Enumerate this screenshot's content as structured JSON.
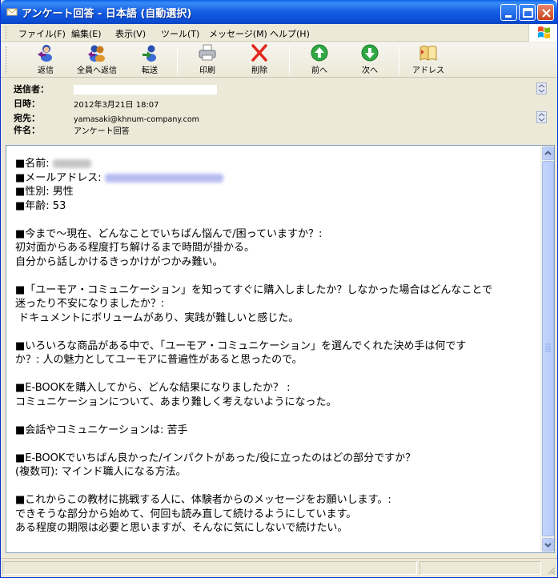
{
  "window": {
    "title": "アンケート回答 - 日本語 (自動選択)"
  },
  "menu": {
    "items": [
      {
        "label": "ファイル(F)"
      },
      {
        "label": "編集(E)"
      },
      {
        "label": "表示(V)"
      },
      {
        "label": "ツール(T)"
      },
      {
        "label": "メッセージ(M)"
      },
      {
        "label": "ヘルプ(H)"
      }
    ]
  },
  "toolbar": {
    "reply": "返信",
    "reply_all": "全員へ返信",
    "forward": "転送",
    "print": "印刷",
    "delete": "削除",
    "previous": "前へ",
    "next": "次へ",
    "address": "アドレス"
  },
  "header": {
    "from_label": "送信者：",
    "date_label": "日時：",
    "date_value": "2012年3月21日 18:07",
    "to_label": "宛先：",
    "to_value": "yamasaki@khnum-company.com",
    "subject_label": "件名：",
    "subject_value": "アンケート回答"
  },
  "body": {
    "name_label": "■名前:",
    "email_label": "■メールアドレス:",
    "gender": "■性別: 男性",
    "age": "■年齢: 53",
    "q1": "■今まで～現在、どんなことでいちばん悩んで/困っていますか？:",
    "a1_line1": "初対面からある程度打ち解けるまで時間が掛かる。",
    "a1_line2": "自分から話しかけるきっかけがつかみ難い。",
    "q2_line1": "■「ユーモア・コミュニケーション」を知ってすぐに購入しましたか？しなかった場合はどんなことで",
    "q2_line2": "迷ったり不安になりましたか？:",
    "a2": " ドキュメントにボリュームがあり、実践が難しいと感じた。",
    "q3_line1": "■いろいろな商品がある中で、「ユーモア・コミュニケーション」を選んでくれた決め手は何です",
    "q3_line2": "か？: 人の魅力としてユーモアに普遍性があると思ったので。",
    "q4": "■E-BOOKを購入してから、どんな結果になりましたか？ :",
    "a4": "コミュニケーションについて、あまり難しく考えないようになった。",
    "q5": "■会話やコミュニケーションは: 苦手",
    "q6_line1": "■E-BOOKでいちばん良かった/インパクトがあった/役に立ったのはどの部分ですか？",
    "q6_line2": "(複数可): マインド職人になる方法。",
    "q7": "■これからこの教材に挑戦する人に、体験者からのメッセージをお願いします。:",
    "a7_line1": "できそうな部分から始めて、何回も読み直して続けるようにしています。",
    "a7_line2": "ある程度の期限は必要と思いますが、そんなに気にしないで続けたい。"
  }
}
